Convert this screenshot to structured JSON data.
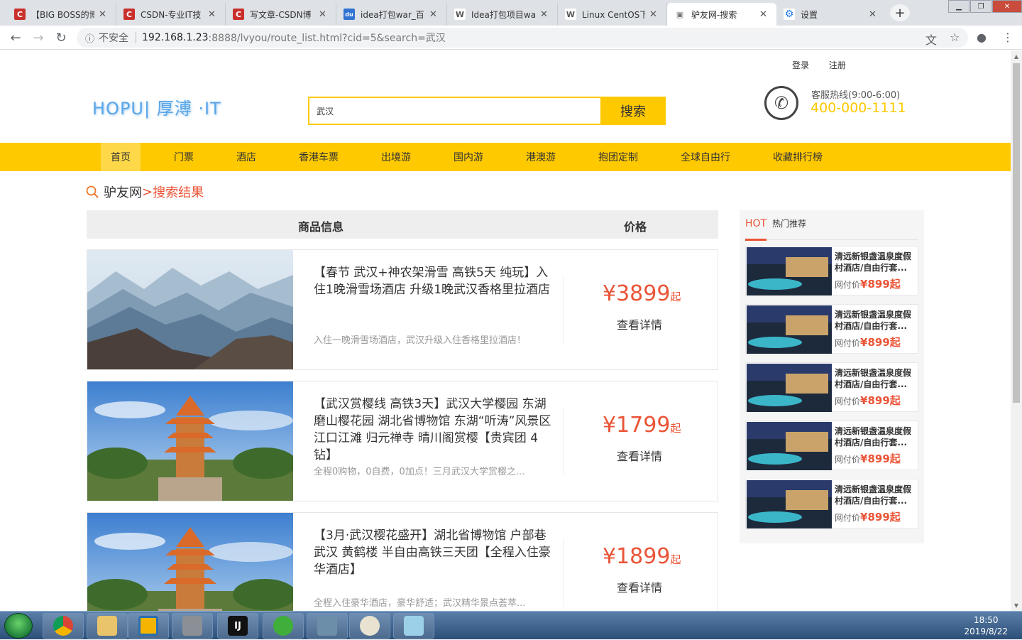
{
  "browser": {
    "tabs": [
      {
        "title": "【BIG BOSS的博",
        "favicon": "C",
        "color": "#c9302c"
      },
      {
        "title": "CSDN-专业IT技",
        "favicon": "C",
        "color": "#c9302c"
      },
      {
        "title": "写文章-CSDN博",
        "favicon": "C",
        "color": "#c9302c"
      },
      {
        "title": "idea打包war_百",
        "favicon": "du",
        "color": "#3173d2"
      },
      {
        "title": "Idea打包项目wa",
        "favicon": "W",
        "color": "#555555"
      },
      {
        "title": "Linux CentOS下",
        "favicon": "W",
        "color": "#555555"
      },
      {
        "title": "驴友网-搜索",
        "favicon": "▣",
        "color": "#777777"
      },
      {
        "title": "设置",
        "favicon": "⚙",
        "color": "#1a73e8"
      }
    ],
    "active_tab_index": 6,
    "address": {
      "security_label": "不安全",
      "host": "192.168.1.23",
      "path": ":8888/lvyou/route_list.html?cid=5&search=武汉"
    }
  },
  "header": {
    "login": "登录",
    "register": "注册",
    "logo_text": "HOPU| 厚溥 ·IT",
    "search_value": "武汉",
    "search_button": "搜索",
    "hotline_label": "客服热线(9:00-6:00)",
    "hotline_number": "400-000-1111"
  },
  "nav": {
    "items": [
      "首页",
      "门票",
      "酒店",
      "香港车票",
      "出境游",
      "国内游",
      "港澳游",
      "抱团定制",
      "全球自由行",
      "收藏排行榜"
    ],
    "active_index": 0
  },
  "breadcrumb": {
    "site": "驴友网",
    "separator": ">",
    "current": "搜索结果"
  },
  "list": {
    "header_info": "商品信息",
    "header_price": "价格",
    "routes": [
      {
        "title": "【春节 武汉+神农架滑雪 高铁5天 纯玩】入住1晚滑雪场酒店 升级1晚武汉香格里拉酒店",
        "desc": "入住一晚滑雪场酒店，武汉升级入住香格里拉酒店！",
        "price": "¥3899",
        "price_suffix": "起",
        "detail": "查看详情",
        "image": "mountains"
      },
      {
        "title": "【武汉赏樱线 高铁3天】武汉大学樱园 东湖磨山樱花园 湖北省博物馆 东湖“听涛”风景区 江口江滩 归元禅寺 晴川阁赏樱【贵宾团 4钻】",
        "desc": "全程0购物，0自费，0加点！三月武汉大学赏樱之...",
        "price": "¥1799",
        "price_suffix": "起",
        "detail": "查看详情",
        "image": "pagoda"
      },
      {
        "title": "【3月·武汉樱花盛开】湖北省博物馆 户部巷 武汉 黄鹤楼 半自由高铁三天团【全程入住豪华酒店】",
        "desc": "全程入住豪华酒店，豪华舒适；武汉精华景点荟萃...",
        "price": "¥1899",
        "price_suffix": "起",
        "detail": "查看详情",
        "image": "pagoda"
      }
    ]
  },
  "hot": {
    "tag": "HOT",
    "title": "热门推荐",
    "items": [
      {
        "name": "清远新银盏温泉度假村酒店/自由行套...",
        "label": "网付价",
        "price": "¥899起"
      },
      {
        "name": "清远新银盏温泉度假村酒店/自由行套...",
        "label": "网付价",
        "price": "¥899起"
      },
      {
        "name": "清远新银盏温泉度假村酒店/自由行套...",
        "label": "网付价",
        "price": "¥899起"
      },
      {
        "name": "清远新银盏温泉度假村酒店/自由行套...",
        "label": "网付价",
        "price": "¥899起"
      },
      {
        "name": "清远新银盏温泉度假村酒店/自由行套...",
        "label": "网付价",
        "price": "¥899起"
      }
    ]
  },
  "taskbar": {
    "time": "18:50",
    "date": "2019/8/22"
  },
  "colors": {
    "accent": "#ffc900",
    "price": "#ea5436",
    "logo": "#5aa6e8"
  }
}
